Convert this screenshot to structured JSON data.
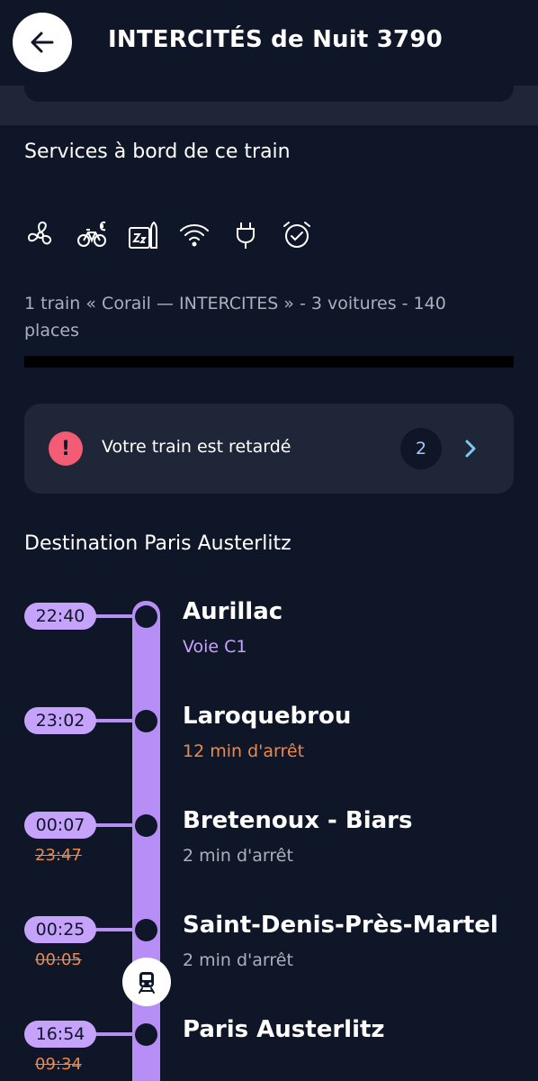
{
  "header": {
    "title": "INTERCITÉS de Nuit 3790",
    "back_icon": "arrow-left-icon"
  },
  "services": {
    "title": "Services à bord de ce train",
    "icons": [
      "fan-icon",
      "bike-paid-icon",
      "sleep-icon",
      "wifi-icon",
      "plug-icon",
      "alarm-clock-icon"
    ],
    "train_info": "1 train « Corail — INTERCITES » - 3 voitures - 140 places"
  },
  "alert": {
    "text": "Votre train est retardé",
    "count": "2",
    "icon": "exclamation-icon",
    "color": "#f45b74"
  },
  "destination": {
    "title": "Destination Paris Austerlitz"
  },
  "colors": {
    "background": "#0f1627",
    "card": "#1e2638",
    "timeline": "#b78ef6",
    "delay": "#e98a4f"
  },
  "stops": [
    {
      "time": "22:40",
      "name": "Aurillac",
      "sub": "Voie C1",
      "old_time": ""
    },
    {
      "time": "23:02",
      "name": "Laroquebrou",
      "sub": "12 min d'arrêt",
      "old_time": ""
    },
    {
      "time": "00:07",
      "name": "Bretenoux - Biars",
      "sub": "2 min d'arrêt",
      "old_time": "23:47"
    },
    {
      "time": "00:25",
      "name": "Saint-Denis-Près-Martel",
      "sub": "2 min d'arrêt",
      "old_time": "00:05"
    },
    {
      "time": "16:54",
      "name": "Paris Austerlitz",
      "sub": "",
      "old_time": "09:34"
    }
  ]
}
